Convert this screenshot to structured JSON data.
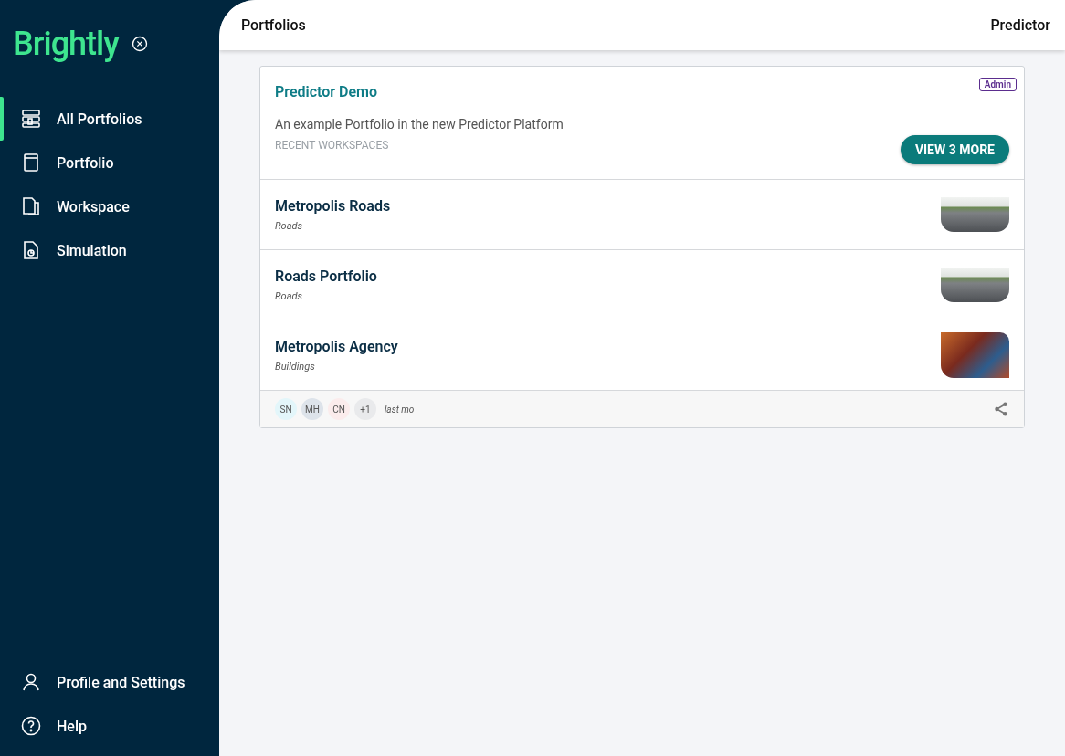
{
  "sidebar": {
    "logo": "Brightly",
    "nav": [
      {
        "label": "All Portfolios",
        "kind": "portfolios",
        "selected": true
      },
      {
        "label": "Portfolio",
        "kind": "book",
        "selected": false
      },
      {
        "label": "Workspace",
        "kind": "pages",
        "selected": false
      },
      {
        "label": "Simulation",
        "kind": "doc",
        "selected": false
      }
    ],
    "bottom": [
      {
        "label": "Profile and Settings",
        "kind": "person"
      },
      {
        "label": "Help",
        "kind": "help"
      }
    ]
  },
  "header": {
    "title": "Portfolios",
    "app": "Predictor"
  },
  "card": {
    "title": "Predictor Demo",
    "badge": "Admin",
    "description": "An example Portfolio in the new Predictor Platform",
    "section_label": "RECENT WORKSPACES",
    "button": "VIEW 3 MORE",
    "workspaces": [
      {
        "name": "Metropolis Roads",
        "type": "Roads"
      },
      {
        "name": "Roads Portfolio",
        "type": "Roads"
      },
      {
        "name": "Metropolis Agency",
        "type": "Buildings"
      }
    ],
    "avatars": [
      {
        "initials": "SN",
        "color": "#e3f6fa"
      },
      {
        "initials": "MH",
        "color": "#dde3ea"
      },
      {
        "initials": "CN",
        "color": "#fbecec"
      },
      {
        "initials": "+1",
        "color": "#e9eaec"
      }
    ],
    "updated": "last mo"
  }
}
